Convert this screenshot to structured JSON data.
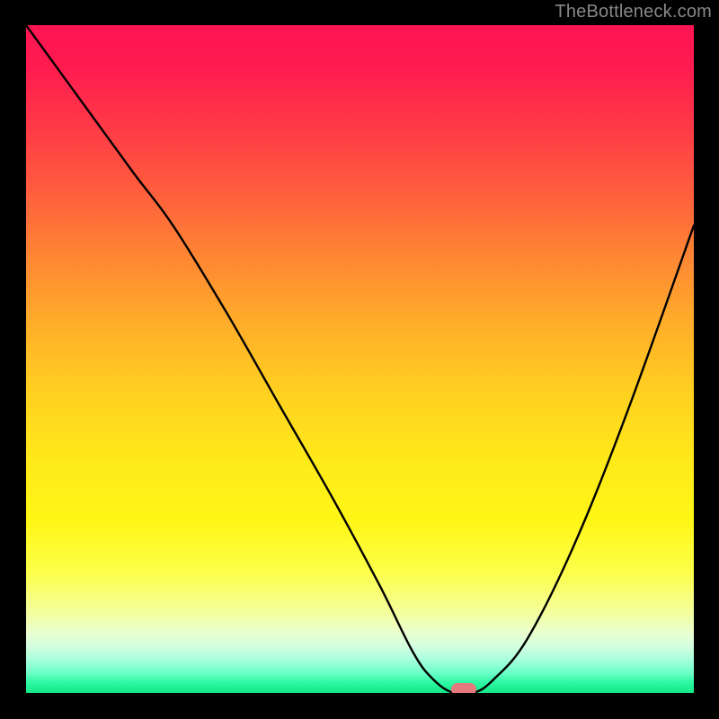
{
  "watermark": "TheBottleneck.com",
  "chart_data": {
    "type": "line",
    "title": "",
    "xlabel": "",
    "ylabel": "",
    "xlim": [
      0,
      100
    ],
    "ylim": [
      0,
      100
    ],
    "x": [
      0,
      8,
      16,
      22,
      30,
      38,
      46,
      53,
      58,
      61,
      64,
      67,
      70,
      75,
      82,
      90,
      100
    ],
    "y": [
      100,
      89,
      78,
      70,
      57,
      43,
      29,
      16,
      6,
      2,
      0,
      0,
      2,
      8,
      22,
      42,
      70
    ],
    "curve_note": "V-shaped bottleneck curve; minimum ≈ x=65, y=0",
    "marker": {
      "x": 65.5,
      "y": 0.5,
      "color": "#e47a7e",
      "shape": "pill"
    },
    "background_gradient": {
      "orientation": "vertical",
      "stops": [
        {
          "pos": 0.0,
          "color": "#ff1452"
        },
        {
          "pos": 0.5,
          "color": "#ffd020"
        },
        {
          "pos": 0.82,
          "color": "#fcff4a"
        },
        {
          "pos": 1.0,
          "color": "#13e887"
        }
      ]
    }
  }
}
